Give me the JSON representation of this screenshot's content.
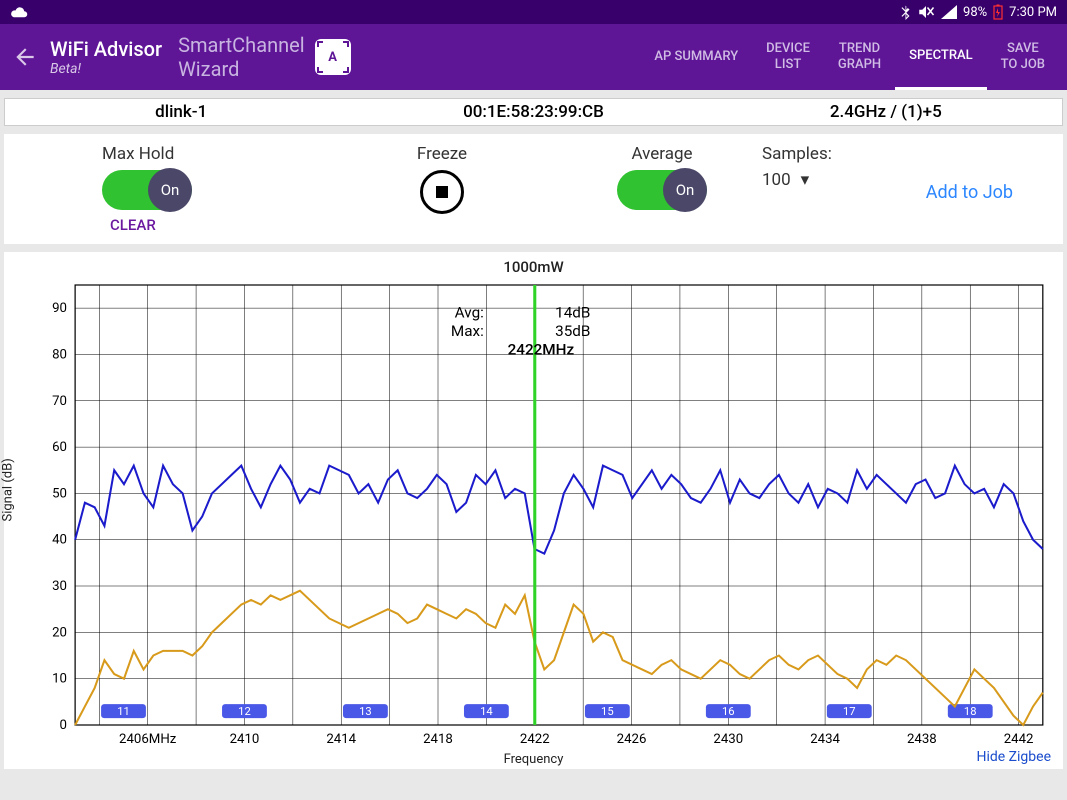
{
  "status": {
    "battery": "98%",
    "time": "7:30 PM"
  },
  "appbar": {
    "title": "WiFi Advisor",
    "subtitle": "Beta!",
    "sc_line1": "SmartChannel",
    "sc_line2": "Wizard",
    "tabs": [
      "AP SUMMARY",
      "DEVICE LIST",
      "TREND GRAPH",
      "SPECTRAL",
      "SAVE TO JOB"
    ],
    "active_tab": 3
  },
  "info": {
    "ssid": "dlink-1",
    "mac": "00:1E:58:23:99:CB",
    "band": "2.4GHz / (1)+5"
  },
  "controls": {
    "maxhold_label": "Max Hold",
    "maxhold_state": "On",
    "freeze_label": "Freeze",
    "average_label": "Average",
    "average_state": "On",
    "samples_label": "Samples:",
    "samples_value": "100",
    "clear": "CLEAR",
    "addjob": "Add to Job"
  },
  "chart": {
    "title": "1000mW",
    "ylabel": "Signal (dB)",
    "xlabel": "Frequency",
    "hide": "Hide Zigbee",
    "anno": {
      "avg_lbl": "Avg:",
      "avg_val": "14dB",
      "max_lbl": "Max:",
      "max_val": "35dB",
      "freq": "2422MHz"
    }
  },
  "chart_data": {
    "type": "line",
    "xlabel": "Frequency",
    "ylabel": "Signal (dB)",
    "ylim": [
      0,
      95
    ],
    "xlim": [
      2403,
      2443
    ],
    "xticks": [
      2406,
      2410,
      2414,
      2418,
      2422,
      2426,
      2430,
      2434,
      2438,
      2442
    ],
    "xtick_labels": [
      "2406MHz",
      "2410",
      "2414",
      "2418",
      "2422",
      "2426",
      "2430",
      "2434",
      "2438",
      "2442"
    ],
    "yticks": [
      0,
      10,
      20,
      30,
      40,
      50,
      60,
      70,
      80,
      90
    ],
    "cursor_x": 2422,
    "channels": [
      11,
      12,
      13,
      14,
      15,
      16,
      17,
      18
    ],
    "series": [
      {
        "name": "Max",
        "color": "#1b1bcc",
        "y": [
          40,
          48,
          47,
          43,
          55,
          52,
          56,
          50,
          47,
          56,
          52,
          50,
          42,
          45,
          50,
          52,
          54,
          56,
          51,
          47,
          52,
          56,
          53,
          48,
          51,
          50,
          56,
          55,
          54,
          50,
          52,
          48,
          53,
          55,
          50,
          49,
          51,
          54,
          52,
          46,
          48,
          54,
          52,
          55,
          49,
          51,
          50,
          38,
          37,
          42,
          50,
          54,
          51,
          47,
          56,
          55,
          54,
          49,
          52,
          55,
          51,
          54,
          52,
          49,
          48,
          51,
          55,
          48,
          53,
          50,
          49,
          52,
          54,
          50,
          48,
          52,
          47,
          51,
          50,
          48,
          55,
          51,
          54,
          52,
          50,
          48,
          52,
          53,
          49,
          50,
          56,
          52,
          50,
          51,
          47,
          52,
          50,
          44,
          40,
          38
        ]
      },
      {
        "name": "Avg",
        "color": "#d89a1b",
        "y": [
          0,
          4,
          8,
          14,
          11,
          10,
          16,
          12,
          15,
          16,
          16,
          16,
          15,
          17,
          20,
          22,
          24,
          26,
          27,
          26,
          28,
          27,
          28,
          29,
          27,
          25,
          23,
          22,
          21,
          22,
          23,
          24,
          25,
          24,
          22,
          23,
          26,
          25,
          24,
          23,
          25,
          24,
          22,
          21,
          26,
          24,
          28,
          18,
          12,
          14,
          20,
          26,
          24,
          18,
          20,
          19,
          14,
          13,
          12,
          11,
          13,
          14,
          12,
          11,
          10,
          12,
          14,
          13,
          11,
          10,
          12,
          14,
          15,
          13,
          12,
          14,
          15,
          13,
          11,
          10,
          8,
          12,
          14,
          13,
          15,
          14,
          12,
          10,
          8,
          6,
          4,
          8,
          12,
          10,
          8,
          5,
          2,
          0,
          4,
          7
        ]
      }
    ]
  }
}
